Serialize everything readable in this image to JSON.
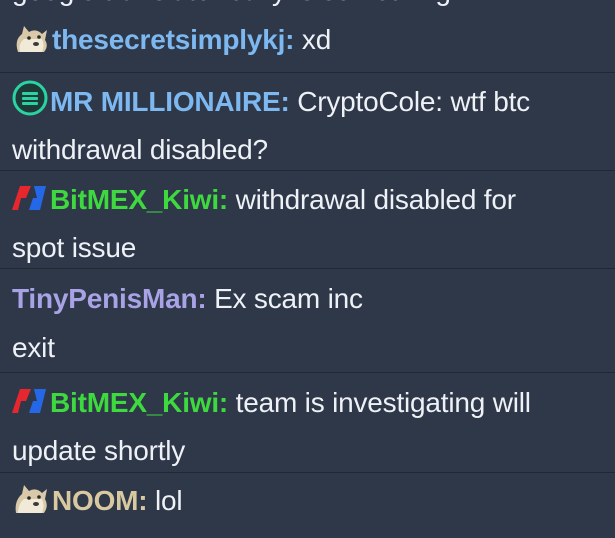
{
  "colors": {
    "background": "#2e3849",
    "divider": "#202836",
    "text": "#eef1f6",
    "name_blue": "#7db8f0",
    "name_green": "#3ed93e",
    "name_purple": "#a9a3e6",
    "name_tan": "#d8c9a0",
    "bitmex_red": "#e8262d",
    "bitmex_blue": "#2468e8",
    "millionaire_green": "#2bd3a3"
  },
  "partial_top_text": "google translate really is something",
  "messages": [
    {
      "user": "thesecretsimplykj:",
      "icon": "doge-avatar-icon",
      "text": "xd"
    },
    {
      "user": "MR MILLIONAIRE:",
      "icon": "millionaire-badge-icon",
      "text": "CryptoCole: wtf btc",
      "text2": "withdrawal disabled?"
    },
    {
      "user": "BitMEX_Kiwi:",
      "icon": "bitmex-logo-icon",
      "text": "withdrawal disabled for",
      "text2": "spot issue"
    },
    {
      "user": "TinyPenisMan:",
      "icon": "",
      "text": "Ex scam inc",
      "text2": "exit"
    },
    {
      "user": "BitMEX_Kiwi:",
      "icon": "bitmex-logo-icon",
      "text": "team is investigating will",
      "text2": "update shortly"
    },
    {
      "user": "NOOM:",
      "icon": "doge-avatar-icon",
      "text": "lol"
    }
  ]
}
